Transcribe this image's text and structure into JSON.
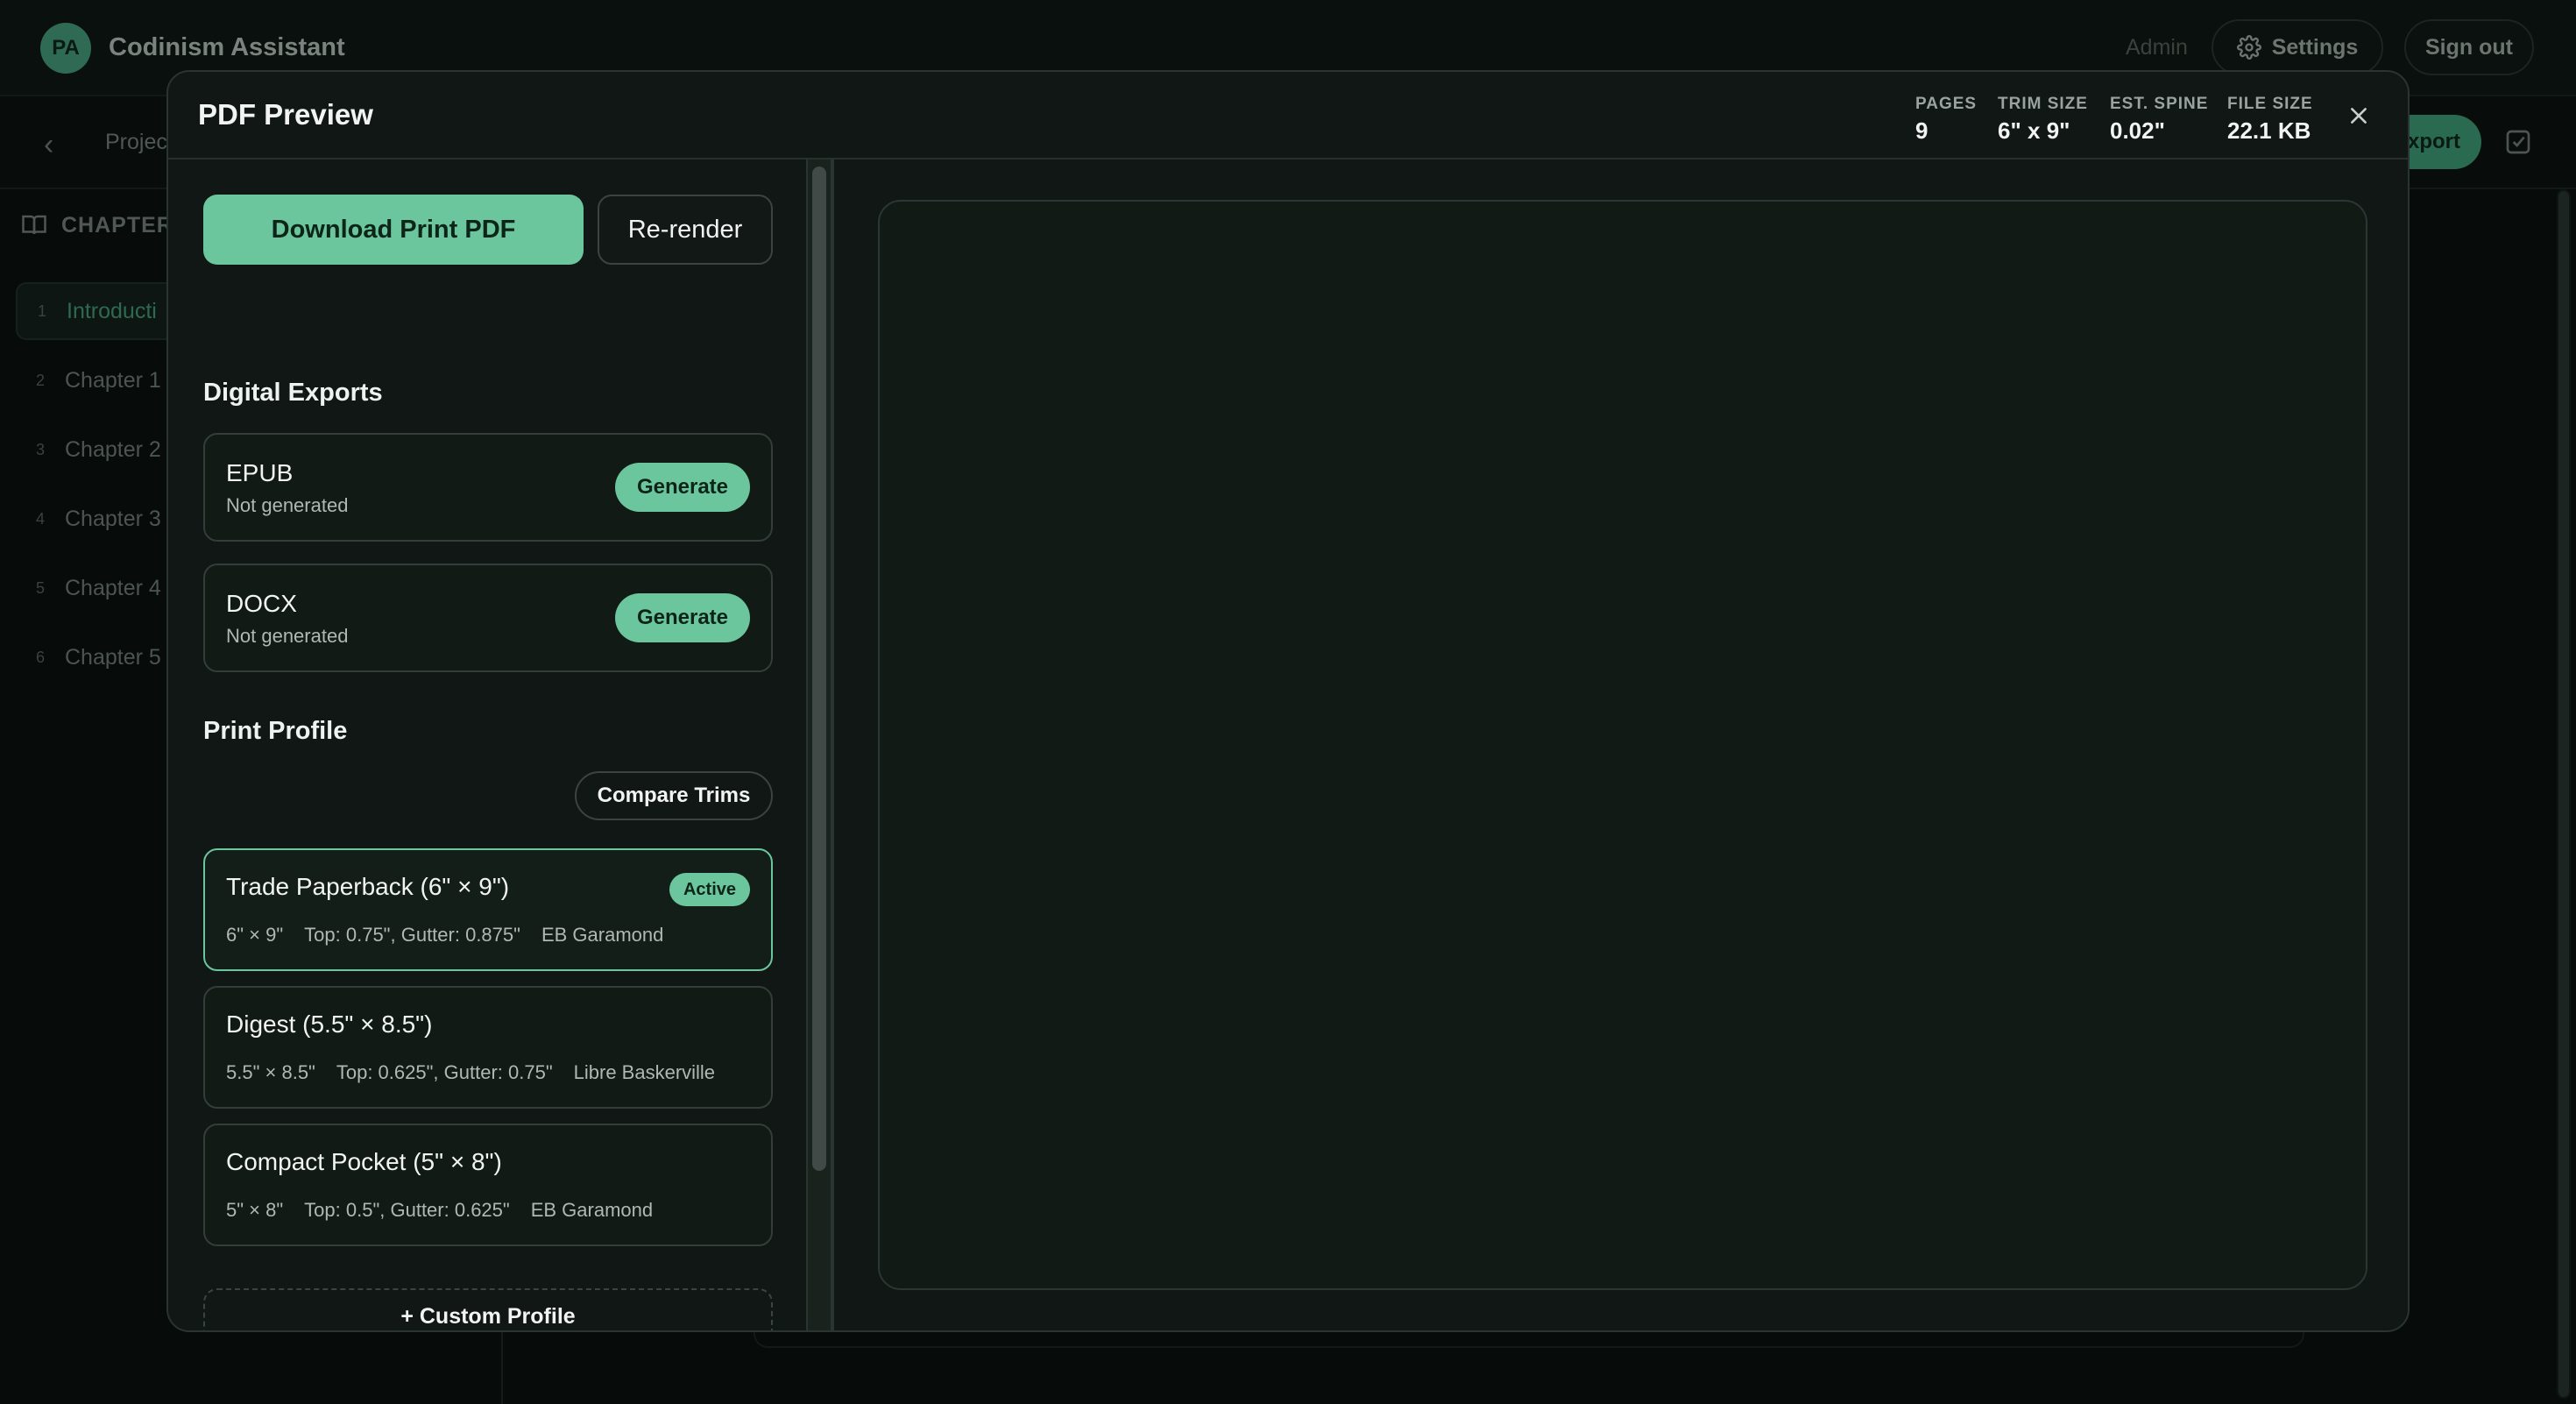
{
  "app": {
    "avatar_initials": "PA",
    "title": "Codinism Assistant",
    "role": "Admin",
    "settings_label": "Settings",
    "signout_label": "Sign out"
  },
  "subbar": {
    "breadcrumb": "Projec",
    "export_label": "xport"
  },
  "sidebar": {
    "heading": "CHAPTER",
    "chapters": [
      {
        "num": "1",
        "label": "Introducti"
      },
      {
        "num": "2",
        "label": "Chapter 1"
      },
      {
        "num": "3",
        "label": "Chapter 2"
      },
      {
        "num": "4",
        "label": "Chapter 3"
      },
      {
        "num": "5",
        "label": "Chapter 4"
      },
      {
        "num": "6",
        "label": "Chapter 5"
      }
    ]
  },
  "modal": {
    "title": "PDF Preview",
    "stats": [
      {
        "label": "PAGES",
        "value": "9"
      },
      {
        "label": "TRIM SIZE",
        "value": "6\" x 9\""
      },
      {
        "label": "EST. SPINE",
        "value": "0.02\""
      },
      {
        "label": "FILE SIZE",
        "value": "22.1 KB"
      }
    ],
    "download_label": "Download Print PDF",
    "rerender_label": "Re-render",
    "digital_exports_title": "Digital Exports",
    "exports": [
      {
        "name": "EPUB",
        "status": "Not generated",
        "button": "Generate"
      },
      {
        "name": "DOCX",
        "status": "Not generated",
        "button": "Generate"
      }
    ],
    "print_profile_title": "Print Profile",
    "compare_label": "Compare Trims",
    "profiles": [
      {
        "name": "Trade Paperback (6\" × 9\")",
        "size": "6\" × 9\"",
        "margins": "Top: 0.75\", Gutter: 0.875\"",
        "font": "EB Garamond",
        "badge": "Active"
      },
      {
        "name": "Digest (5.5\" × 8.5\")",
        "size": "5.5\" × 8.5\"",
        "margins": "Top: 0.625\", Gutter: 0.75\"",
        "font": "Libre Baskerville"
      },
      {
        "name": "Compact Pocket (5\" × 8\")",
        "size": "5\" × 8\"",
        "margins": "Top: 0.5\", Gutter: 0.625\"",
        "font": "EB Garamond"
      }
    ],
    "custom_profile_label": "+ Custom Profile"
  },
  "colors": {
    "accent": "#6cc69d",
    "modal_bg": "#101714",
    "page_bg": "#070b09"
  }
}
